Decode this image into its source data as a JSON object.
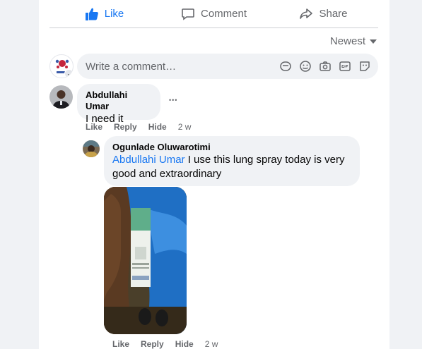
{
  "actions": {
    "like": "Like",
    "comment": "Comment",
    "share": "Share"
  },
  "sort": {
    "label": "Newest"
  },
  "composer": {
    "placeholder": "Write a comment…",
    "icons": [
      "sticker-icon",
      "emoji-icon",
      "camera-icon",
      "gif-icon",
      "avatar-sticker-icon"
    ]
  },
  "comments": [
    {
      "author": "Abdullahi Umar",
      "text": "I need it",
      "actions": {
        "like": "Like",
        "reply": "Reply",
        "hide": "Hide",
        "time": "2 w"
      },
      "more": "•••"
    }
  ],
  "reply": {
    "author": "Ogunlade Oluwarotimi",
    "mention": "Abdullahi Umar",
    "text": "I use this lung spray today is very good and extraordinary",
    "attachment": "photo",
    "actions": {
      "like": "Like",
      "reply": "Reply",
      "hide": "Hide",
      "time": "2 w"
    }
  },
  "colors": {
    "accent": "#1877f2",
    "bubble": "#f0f2f5",
    "muted": "#65676b"
  }
}
